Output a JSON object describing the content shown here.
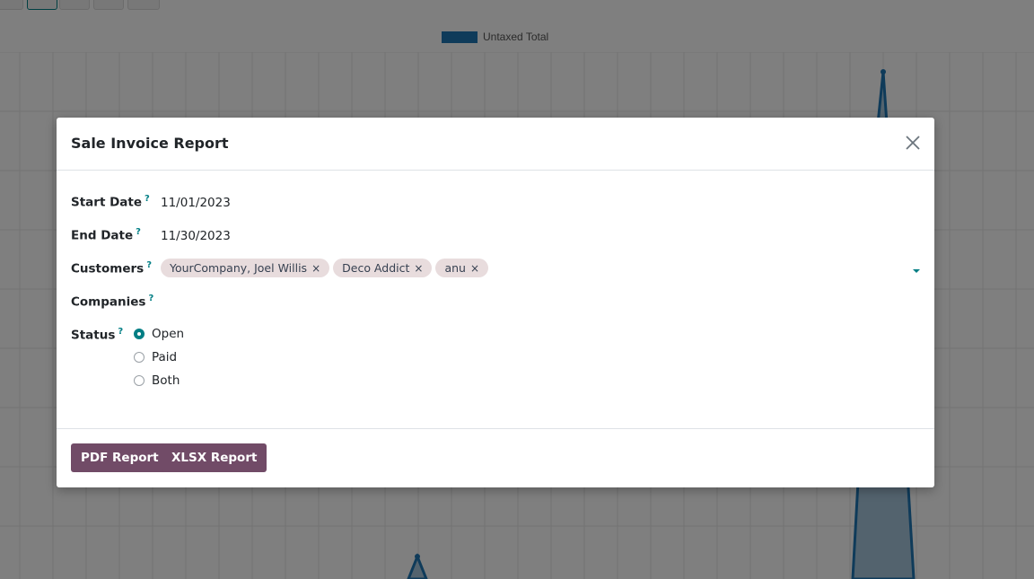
{
  "background": {
    "legend_label": "Untaxed Total",
    "colors": {
      "series": "#1f77b4"
    }
  },
  "dialog": {
    "title": "Sale Invoice Report",
    "fields": {
      "start_date": {
        "label": "Start Date",
        "help": "?",
        "value": "11/01/2023"
      },
      "end_date": {
        "label": "End Date",
        "help": "?",
        "value": "11/30/2023"
      },
      "customers": {
        "label": "Customers",
        "help": "?",
        "tags": [
          "YourCompany, Joel Willis",
          "Deco Addict",
          "anu"
        ]
      },
      "companies": {
        "label": "Companies",
        "help": "?",
        "value": ""
      },
      "status": {
        "label": "Status",
        "help": "?",
        "options": [
          "Open",
          "Paid",
          "Both"
        ],
        "selected": "Open"
      }
    },
    "buttons": {
      "pdf": "PDF Report",
      "xlsx": "XLSX Report"
    },
    "close_icon": "close-icon",
    "colors": {
      "accent": "#017e84",
      "primary_button": "#714b67",
      "tag_bg": "#e8dcdd"
    }
  }
}
